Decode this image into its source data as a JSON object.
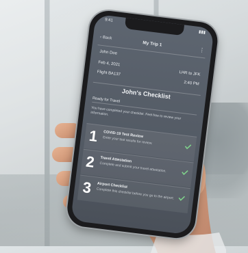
{
  "phone": {
    "status_time": "9:41",
    "status_icons": "▮▮▮",
    "nav": {
      "back": "Back",
      "title": "My Trip 1"
    },
    "trip": {
      "name": "John Doe",
      "date": "Feb 4, 2021",
      "route": "LHR to JFK",
      "flight": "Flight BA137",
      "time": "2:40 PM"
    },
    "checklist_title": "John's Checklist",
    "ready_label": "Ready for Travel",
    "ready_message": "You have completed your checklist. Feel free to review your information.",
    "steps": [
      {
        "num": "1",
        "title": "COVID-19 Test Review",
        "desc": "Enter your test results for review."
      },
      {
        "num": "2",
        "title": "Travel Attestation",
        "desc": "Complete and submit your travel attestation."
      },
      {
        "num": "3",
        "title": "Airport Checklist",
        "desc": "Complete this checklist before you go to the airport."
      }
    ],
    "colors": {
      "check": "#7fd18b",
      "screen": "#5a626c"
    }
  }
}
